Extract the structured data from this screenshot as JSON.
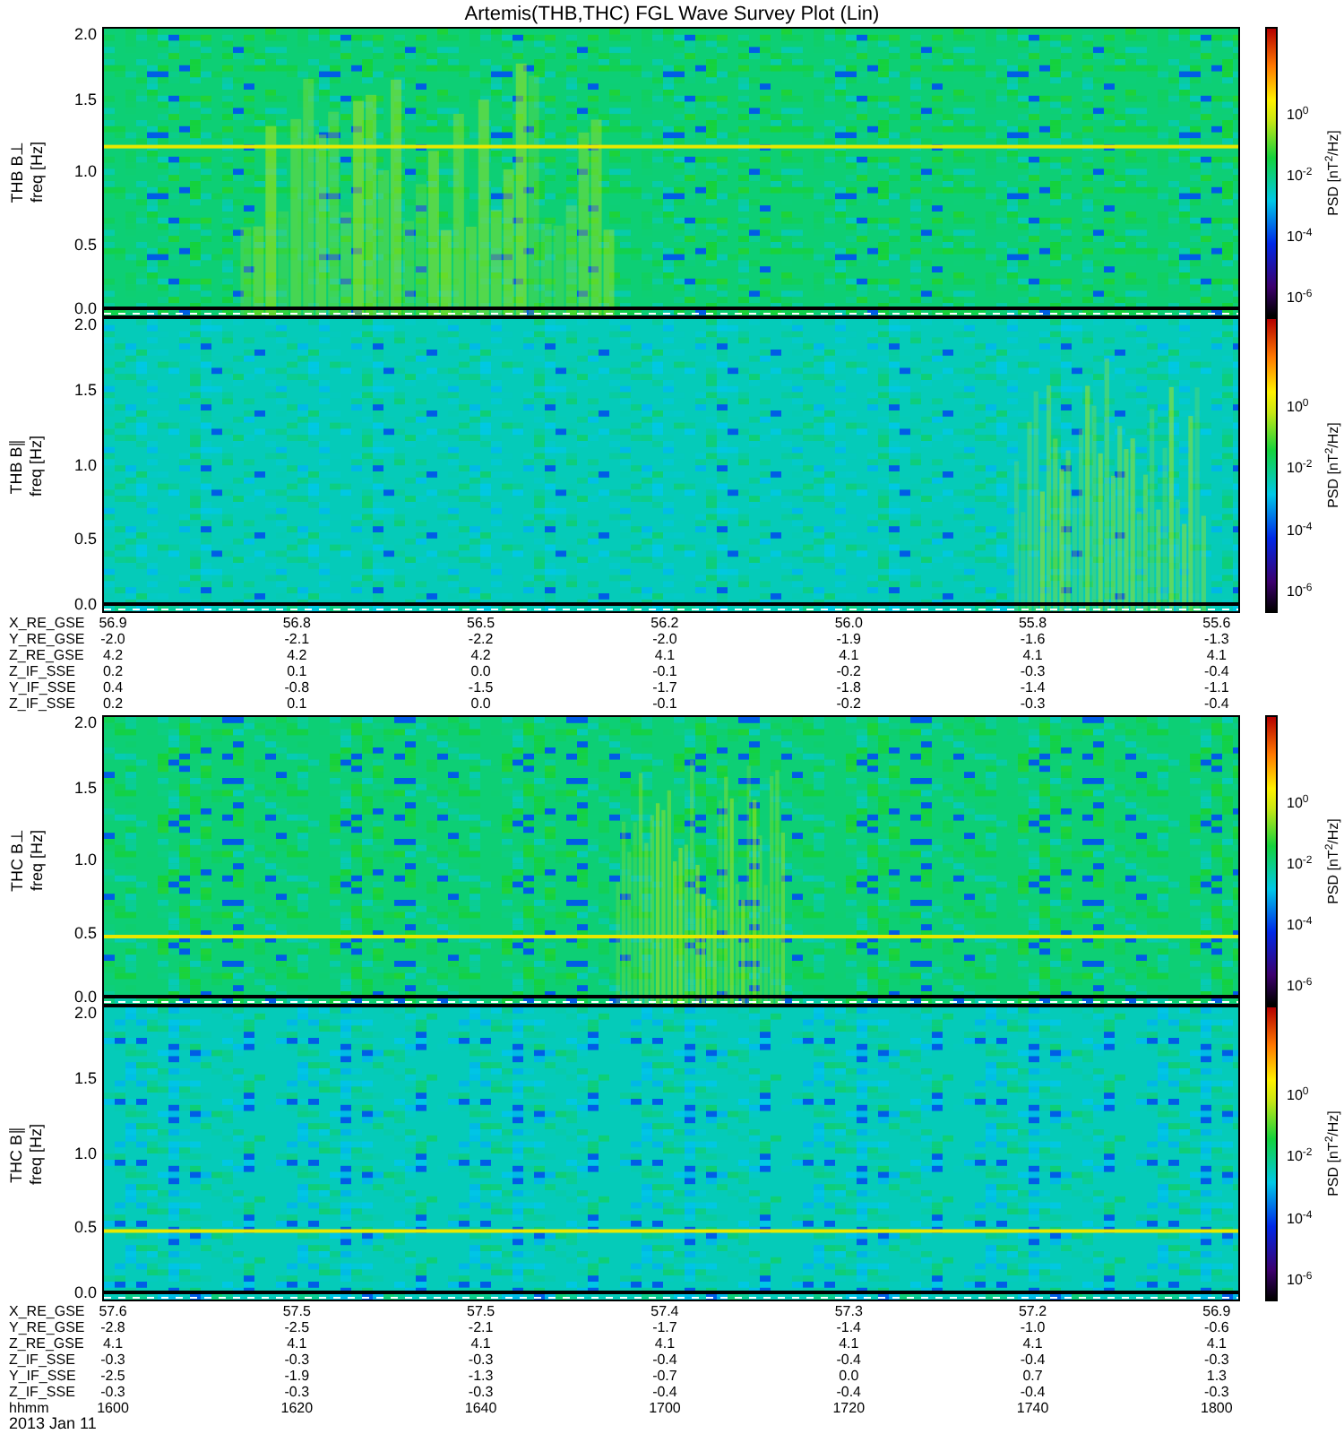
{
  "title": "Artemis(THB,THC) FGL Wave Survey Plot (Lin)",
  "sections": [
    {
      "panels": [
        {
          "label": "THB B⊥",
          "axis_label": "freq [Hz]",
          "yticks": [
            "2.0",
            "1.5",
            "1.0",
            "0.5",
            "0.0"
          ],
          "colorbar_ticks": [
            "10$^{0}$",
            "10$^{-2}$",
            "10$^{-4}$",
            "10$^{-6}$"
          ],
          "colorbar_label": "PSD [nT$^{2}$/Hz]"
        },
        {
          "label": "THB B∥",
          "axis_label": "freq [Hz]",
          "yticks": [
            "2.0",
            "1.5",
            "1.0",
            "0.5",
            "0.0"
          ],
          "colorbar_ticks": [
            "10$^{0}$",
            "10$^{-2}$",
            "10$^{-4}$",
            "10$^{-6}$"
          ],
          "colorbar_label": "PSD [nT$^{2}$/Hz]"
        }
      ],
      "table": [
        {
          "name": "X_RE_GSE",
          "values": [
            "56.9",
            "56.8",
            "56.5",
            "56.2",
            "56.0",
            "55.8",
            "55.6"
          ]
        },
        {
          "name": "Y_RE_GSE",
          "values": [
            "-2.0",
            "-2.1",
            "-2.2",
            "-2.0",
            "-1.9",
            "-1.6",
            "-1.3"
          ]
        },
        {
          "name": "Z_RE_GSE",
          "values": [
            "4.2",
            "4.2",
            "4.2",
            "4.1",
            "4.1",
            "4.1",
            "4.1"
          ]
        },
        {
          "name": "Z_IF_SSE",
          "values": [
            "0.2",
            "0.1",
            "0.0",
            "-0.1",
            "-0.2",
            "-0.3",
            "-0.4"
          ]
        },
        {
          "name": "Y_IF_SSE",
          "values": [
            "0.4",
            "-0.8",
            "-1.5",
            "-1.7",
            "-1.8",
            "-1.4",
            "-1.1"
          ]
        },
        {
          "name": "Z_IF_SSE",
          "values": [
            "0.2",
            "0.1",
            "0.0",
            "-0.1",
            "-0.2",
            "-0.3",
            "-0.4"
          ]
        }
      ]
    },
    {
      "panels": [
        {
          "label": "THC B⊥",
          "axis_label": "freq [Hz]",
          "yticks": [
            "2.0",
            "1.5",
            "1.0",
            "0.5",
            "0.0"
          ],
          "colorbar_ticks": [
            "10$^{0}$",
            "10$^{-2}$",
            "10$^{-4}$",
            "10$^{-6}$"
          ],
          "colorbar_label": "PSD [nT$^{2}$/Hz]"
        },
        {
          "label": "THC B∥",
          "axis_label": "freq [Hz]",
          "yticks": [
            "2.0",
            "1.5",
            "1.0",
            "0.5",
            "0.0"
          ],
          "colorbar_ticks": [
            "10$^{0}$",
            "10$^{-2}$",
            "10$^{-4}$",
            "10$^{-6}$"
          ],
          "colorbar_label": "PSD [nT$^{2}$/Hz]"
        }
      ],
      "table": [
        {
          "name": "X_RE_GSE",
          "values": [
            "57.6",
            "57.5",
            "57.5",
            "57.4",
            "57.3",
            "57.2",
            "56.9"
          ]
        },
        {
          "name": "Y_RE_GSE",
          "values": [
            "-2.8",
            "-2.5",
            "-2.1",
            "-1.7",
            "-1.4",
            "-1.0",
            "-0.6"
          ]
        },
        {
          "name": "Z_RE_GSE",
          "values": [
            "4.1",
            "4.1",
            "4.1",
            "4.1",
            "4.1",
            "4.1",
            "4.1"
          ]
        },
        {
          "name": "Z_IF_SSE",
          "values": [
            "-0.3",
            "-0.3",
            "-0.3",
            "-0.4",
            "-0.4",
            "-0.4",
            "-0.3"
          ]
        },
        {
          "name": "Y_IF_SSE",
          "values": [
            "-2.5",
            "-1.9",
            "-1.3",
            "-0.7",
            "0.0",
            "0.7",
            "1.3"
          ]
        },
        {
          "name": "Z_IF_SSE",
          "values": [
            "-0.3",
            "-0.3",
            "-0.3",
            "-0.4",
            "-0.4",
            "-0.4",
            "-0.3"
          ]
        },
        {
          "name": "hhmm",
          "values": [
            "1600",
            "1620",
            "1640",
            "1700",
            "1720",
            "1740",
            "1800"
          ]
        }
      ],
      "date": "2013 Jan 11"
    }
  ]
}
